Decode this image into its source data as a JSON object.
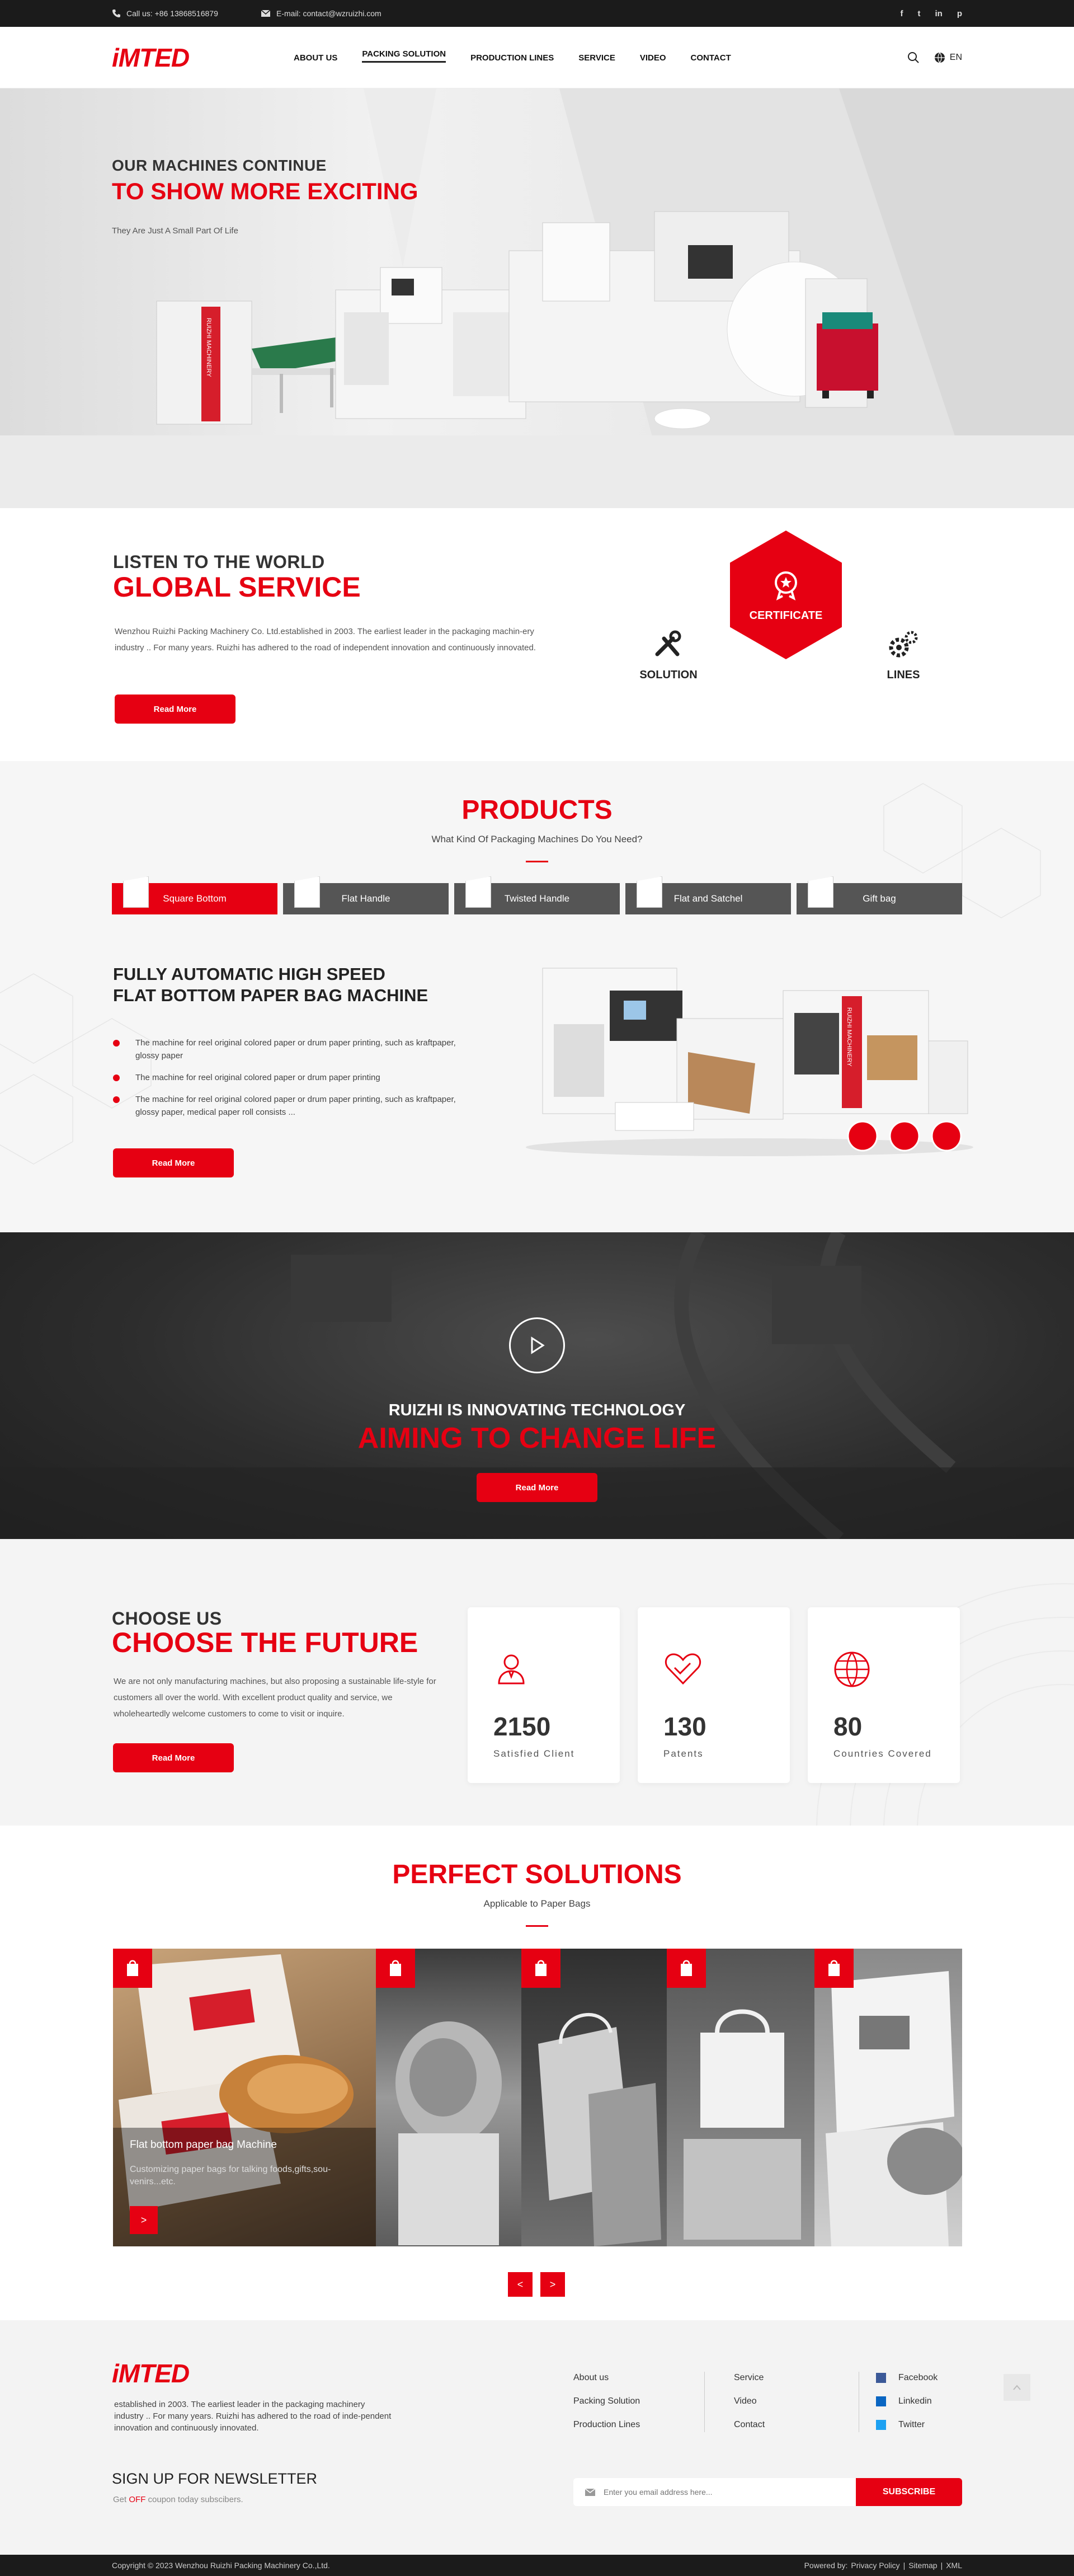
{
  "topbar": {
    "phone": "Call us: +86 13868516879",
    "email": "E-mail: contact@wzruizhi.com",
    "social": [
      "f",
      "t",
      "in",
      "p"
    ]
  },
  "header": {
    "logo": "iMTED",
    "nav": [
      "ABOUT US",
      "PACKING SOLUTION",
      "PRODUCTION LINES",
      "SERVICE",
      "VIDEO",
      "CONTACT"
    ],
    "lang": "EN"
  },
  "hero": {
    "line1": "OUR MACHINES CONTINUE",
    "line2": "TO SHOW MORE EXCITING",
    "line3": "They Are Just A Small Part Of Life",
    "machine_brand": "RUIZHI MACHINERY"
  },
  "service": {
    "sub": "LISTEN TO THE WORLD",
    "title": "GLOBAL SERVICE",
    "text": "Wenzhou Ruizhi Packing Machinery Co. Ltd.established in 2003. The earliest leader in the packaging machin-ery industry .. For many years. Ruizhi has adhered to the road of independent innovation and continuously innovated.",
    "button": "Read More",
    "hex": {
      "certificate": "CERTIFICATE",
      "solution": "SOLUTION",
      "lines": "LINES"
    }
  },
  "products": {
    "title": "PRODUCTS",
    "subtitle": "What Kind Of Packaging Machines Do You Need?",
    "tabs": [
      "Square Bottom",
      "Flat Handle",
      "Twisted Handle",
      "Flat and Satchel",
      "Gift bag"
    ],
    "heading1": "FULLY AUTOMATIC HIGH SPEED",
    "heading2": "FLAT BOTTOM PAPER BAG MACHINE",
    "bullets": [
      "The machine for reel original colored paper or drum paper printing, such as kraftpaper, glossy paper",
      "The machine for reel original colored paper or drum paper printing",
      "The machine for reel original colored paper or drum paper printing, such as kraftpaper, glossy paper, medical paper roll consists ..."
    ],
    "button": "Read More",
    "machine_brand": "RUIZHI MACHINERY"
  },
  "video": {
    "line1": "RUIZHI IS INNOVATING TECHNOLOGY",
    "line2": "AIMING TO CHANGE LIFE",
    "button": "Read More"
  },
  "choose": {
    "sub": "CHOOSE US",
    "title": "CHOOSE THE FUTURE",
    "text": "We are not only manufacturing machines, but also proposing a sustainable life-style for customers all over the world. With excellent product quality and service, we wholeheartedly welcome customers to come to visit or inquire.",
    "button": "Read More",
    "stats": [
      {
        "num": "2150",
        "label": "Satisfied Client",
        "icon": "person-icon"
      },
      {
        "num": "130",
        "label": "Patents",
        "icon": "heart-badge-icon"
      },
      {
        "num": "80",
        "label": "Countries Covered",
        "icon": "globe-icon"
      }
    ]
  },
  "solutions": {
    "title": "PERFECT SOLUTIONS",
    "subtitle": "Applicable to Paper Bags",
    "panel_title": "Flat bottom paper bag Machine",
    "panel_text": "Customizing paper bags for talking foods,gifts,sou-venirs...etc.",
    "prev": "<",
    "next": ">",
    "arrow": ">"
  },
  "footer": {
    "logo": "iMTED",
    "about": "established in 2003. The earliest leader in the packaging machinery industry .. For many years. Ruizhi has adhered to the road of inde-pendent innovation and continuously innovated.",
    "col1": [
      "About us",
      "Packing Solution",
      "Production Lines"
    ],
    "col2": [
      "Service",
      "Video",
      "Contact"
    ],
    "col3": [
      "Facebook",
      "Linkedin",
      "Twitter"
    ],
    "newsletter_title": "SIGN UP FOR NEWSLETTER",
    "newsletter_pre": "Get ",
    "newsletter_off": "OFF",
    "newsletter_post": " coupon today subscibers.",
    "email_placeholder": "Enter you email address here...",
    "subscribe": "SUBSCRIBE",
    "copyright": "Copyright © 2023 Wenzhou Ruizhi Packing Machinery Co.,Ltd.",
    "powered_prefix": "Powered by:",
    "legal": [
      "Privacy Policy",
      "Sitemap",
      "XML"
    ]
  },
  "colors": {
    "accent": "#e60012",
    "dark": "#1b1b1b"
  }
}
